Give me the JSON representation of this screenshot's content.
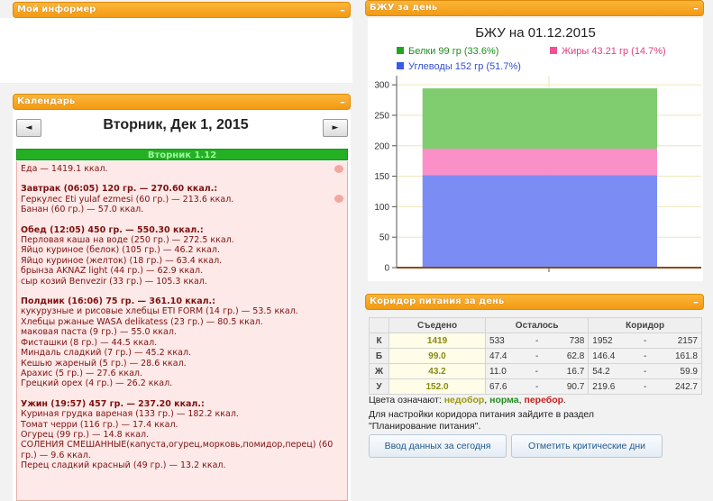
{
  "informer": {
    "title": "Мой информер",
    "collapse": "–"
  },
  "calendar": {
    "title": "Календарь",
    "collapse": "–",
    "prev": "◄",
    "next": "►",
    "date_label": "Вторник, Дек 1, 2015",
    "day_header": "Вторник 1.12",
    "lines": [
      {
        "text": "Еда — 1419.1 ккал.",
        "apple": true
      },
      {
        "gap": true
      },
      {
        "text": "Завтрак (06:05) 120 гр. — 270.60 ккал.:",
        "bold": true
      },
      {
        "text": "Геркулес Eti yulaf ezmesi (60 гр.) — 213.6 ккал."
      },
      {
        "text": "Банан (60 гр.) — 57.0 ккал."
      },
      {
        "gap": true
      },
      {
        "text": "Обед (12:05) 450 гр. — 550.30 ккал.:",
        "bold": true
      },
      {
        "text": "Перловая каша на воде (250 гр.) — 272.5 ккал."
      },
      {
        "text": "Яйцо куриное (белок) (105 гр.) — 46.2 ккал."
      },
      {
        "text": "Яйцо куриное (желток) (18 гр.) — 63.4 ккал."
      },
      {
        "text": "брынза AKNAZ light (44 гр.) — 62.9 ккал."
      },
      {
        "text": "сыр козий Benvezir (33 гр.) — 105.3 ккал."
      },
      {
        "gap": true
      },
      {
        "text": "Полдник (16:06) 75 гр. — 361.10 ккал.:",
        "bold": true
      },
      {
        "text": "кукурузные и рисовые хлебцы ETI FORM (14 гр.) — 53.5 ккал."
      },
      {
        "text": "Хлебцы ржаные WASA delikatess (23 гр.) — 80.5 ккал.",
        "apple": true
      },
      {
        "text": "маковая паста (9 гр.) — 55.0 ккал."
      },
      {
        "text": "Фисташки (8 гр.) — 44.5 ккал."
      },
      {
        "text": "Миндаль сладкий (7 гр.) — 45.2 ккал."
      },
      {
        "text": "Кешью жареный (5 гр.) — 28.6 ккал."
      },
      {
        "text": "Арахис (5 гр.) — 27.6 ккал."
      },
      {
        "text": "Грецкий орех (4 гр.) — 26.2 ккал."
      },
      {
        "gap": true
      },
      {
        "text": "Ужин (19:57) 457 гр. — 237.20 ккал.:",
        "bold": true
      },
      {
        "text": "Куриная грудка вареная (133 гр.) — 182.2 ккал."
      },
      {
        "text": "Томат черри (116 гр.) — 17.4 ккал."
      },
      {
        "text": "Огурец (99 гр.) — 14.8 ккал."
      },
      {
        "text": "СОЛЕНИЯ СМЕШАННЫЕ(капуста,огурец,морковь,помидор,перец) (60"
      },
      {
        "text": "гр.) — 9.6 ккал."
      },
      {
        "text": "Перец сладкий красный (49 гр.) — 13.2 ккал."
      }
    ]
  },
  "bju": {
    "panel_title": "БЖУ за день",
    "collapse": "–",
    "legend": [
      {
        "label": "Белки 99 гр (33.6%)",
        "color": "#22a522",
        "text_color": "#1e8e1e"
      },
      {
        "label": "Жиры 43.21 гр (14.7%)",
        "color": "#f0509a",
        "text_color": "#e0407f"
      },
      {
        "label": "Углеводы 152 гр (51.7%)",
        "color": "#3a5ae8",
        "text_color": "#3050d0"
      }
    ]
  },
  "chart_data": {
    "type": "bar",
    "title": "БЖУ на 01.12.2015",
    "stacked": true,
    "categories": [
      ""
    ],
    "series": [
      {
        "name": "Углеводы 152 гр (51.7%)",
        "values": [
          152
        ],
        "color": "#7b8cf5"
      },
      {
        "name": "Жиры 43.21 гр (14.7%)",
        "values": [
          43.21
        ],
        "color": "#fb8fc8"
      },
      {
        "name": "Белки 99 гр (33.6%)",
        "values": [
          99
        ],
        "color": "#7fcd6e"
      }
    ],
    "ylim": [
      0,
      315
    ],
    "yticks": [
      "0",
      "50",
      "100",
      "150",
      "200",
      "250",
      "300"
    ],
    "grid": true,
    "legend_position": "top"
  },
  "corridor": {
    "panel_title": "Коридор питания за день",
    "collapse": "–",
    "headers": [
      "Съедено",
      "Осталось",
      "Коридор"
    ],
    "rows": [
      {
        "label": "К",
        "eaten": "1419",
        "left_min": "533",
        "left_max": "738",
        "c_min": "1952",
        "c_max": "2157"
      },
      {
        "label": "Б",
        "eaten": "99.0",
        "left_min": "47.4",
        "left_max": "62.8",
        "c_min": "146.4",
        "c_max": "161.8"
      },
      {
        "label": "Ж",
        "eaten": "43.2",
        "left_min": "11.0",
        "left_max": "16.7",
        "c_min": "54.2",
        "c_max": "59.9"
      },
      {
        "label": "У",
        "eaten": "152.0",
        "left_min": "67.6",
        "left_max": "90.7",
        "c_min": "219.6",
        "c_max": "242.7"
      }
    ],
    "dash": "-",
    "colors_prefix": "Цвета означают: ",
    "color_under": "недобор",
    "color_norm": "норма",
    "color_over": "перебор",
    "colors_suffix": ".",
    "settings_line1": "Для настройки коридора питания зайдите в раздел",
    "settings_line2": "\"Планирование питания\".",
    "btn_input": "Ввод данных за сегодня",
    "btn_critical": "Отметить критические дни"
  }
}
